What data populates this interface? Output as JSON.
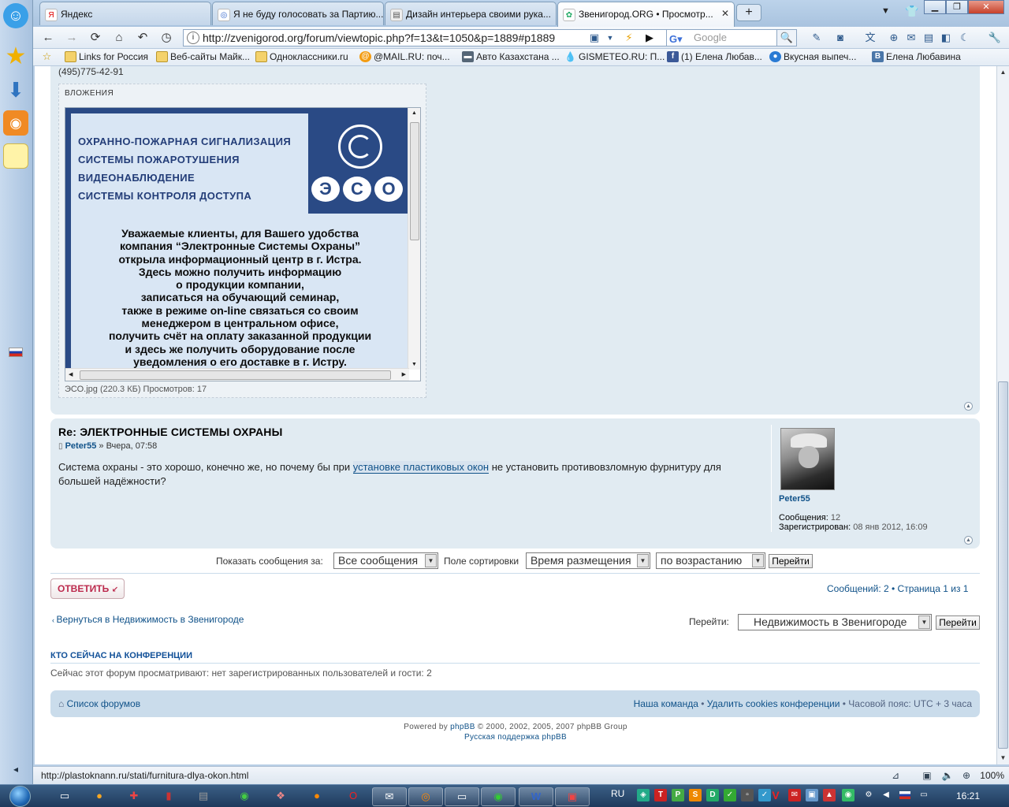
{
  "browser": {
    "tabs": [
      {
        "label": "Яндекс",
        "icon": "yandex-icon"
      },
      {
        "label": "Я не буду голосовать за Партию...",
        "icon": "globe-icon"
      },
      {
        "label": "Дизайн интерьера своими рука...",
        "icon": "page-icon"
      },
      {
        "label": "Звенигород.ORG • Просмотр...",
        "icon": "phpbb-icon"
      }
    ],
    "url": "http://zvenigorod.org/forum/viewtopic.php?f=13&t=1050&p=1889#p1889",
    "search_placeholder": "Google",
    "bookmarks": [
      "Links for Россия",
      "Веб-сайты Майк...",
      "Одноклассники.ru",
      "@MAIL.RU: поч...",
      "Авто Казахстана ...",
      "GISMETEO.RU: П...",
      "(1) Елена Любав...",
      "Вкусная выпеч...",
      "Елена Любавина"
    ],
    "status_url": "http://plastoknann.ru/stati/furnitura-dlya-okon.html",
    "zoom": "100%"
  },
  "post1": {
    "phone": "(495)775-42-91",
    "attachments_title": "ВЛОЖЕНИЯ",
    "image": {
      "services": [
        "ОХРАННО-ПОЖАРНАЯ СИГНАЛИЗАЦИЯ",
        "СИСТЕМЫ ПОЖАРОТУШЕНИЯ",
        "ВИДЕОНАБЛЮДЕНИЕ",
        "СИСТЕМЫ КОНТРОЛЯ ДОСТУПА"
      ],
      "logo_letters": [
        "Э",
        "С",
        "О"
      ],
      "ad_lines": [
        "Уважаемые клиенты, для Вашего удобства",
        "компания “Электронные Системы Охраны”",
        "открыла информационный центр в г. Истра.",
        "Здесь можно получить информацию",
        "о продукции компании,",
        "записаться на обучающий семинар,",
        "также в режиме on-line связаться со своим",
        "менеджером в центральном офисе,",
        "получить счёт на оплату заказанной продукции",
        "и здесь же получить оборудование после",
        "уведомления о его доставке в г. Истру."
      ]
    },
    "caption": "ЭСО.jpg (220.3 КБ) Просмотров: 17"
  },
  "post2": {
    "title": "Re: ЭЛЕКТРОННЫЕ СИСТЕМЫ ОХРАНЫ",
    "author": "Peter55",
    "date": "» Вчера, 07:58",
    "body_before": "Система охраны - это хорошо, конечно же, но почему бы при ",
    "body_link": "установке пластиковых окон",
    "body_after": " не установить противовзломную фурнитуру для большей надёжности?",
    "profile": {
      "name": "Peter55",
      "posts_label": "Сообщения:",
      "posts": "12",
      "registered_label": "Зарегистрирован:",
      "registered": "08 янв 2012, 16:09"
    }
  },
  "sort": {
    "show_label": "Показать сообщения за:",
    "show_value": "Все сообщения",
    "sort_label": "Поле сортировки",
    "sort_value": "Время размещения",
    "order_value": "по возрастанию",
    "go": "Перейти"
  },
  "actions": {
    "reply": "ОТВЕТИТЬ",
    "pagination": "Сообщений: 2 • Страница 1 из 1",
    "back": "Вернуться в Недвижимость в Звенигороде",
    "jump_label": "Перейти:",
    "jump_value": "Недвижимость в Звенигороде",
    "jump_go": "Перейти"
  },
  "online": {
    "title": "КТО СЕЙЧАС НА КОНФЕРЕНЦИИ",
    "text": "Сейчас этот форум просматривают: нет зарегистрированных пользователей и гости: 2"
  },
  "footer": {
    "home": "Список форумов",
    "team": "Наша команда",
    "sep": " • ",
    "cookies": "Удалить cookies конференции",
    "timezone": "Часовой пояс: UTC + 3 часа",
    "powered_prefix": "Powered by ",
    "phpbb": "phpBB",
    "powered_suffix": " © 2000, 2002, 2005, 2007 phpBB Group",
    "support": "Русская поддержка phpBB"
  },
  "taskbar": {
    "lang": "RU",
    "time": "16:21"
  },
  "colors": {
    "post_bg": "#e1ebf2",
    "link": "#105289",
    "reply_text": "#bc2a4d",
    "ad_blue": "#2a4a85"
  }
}
